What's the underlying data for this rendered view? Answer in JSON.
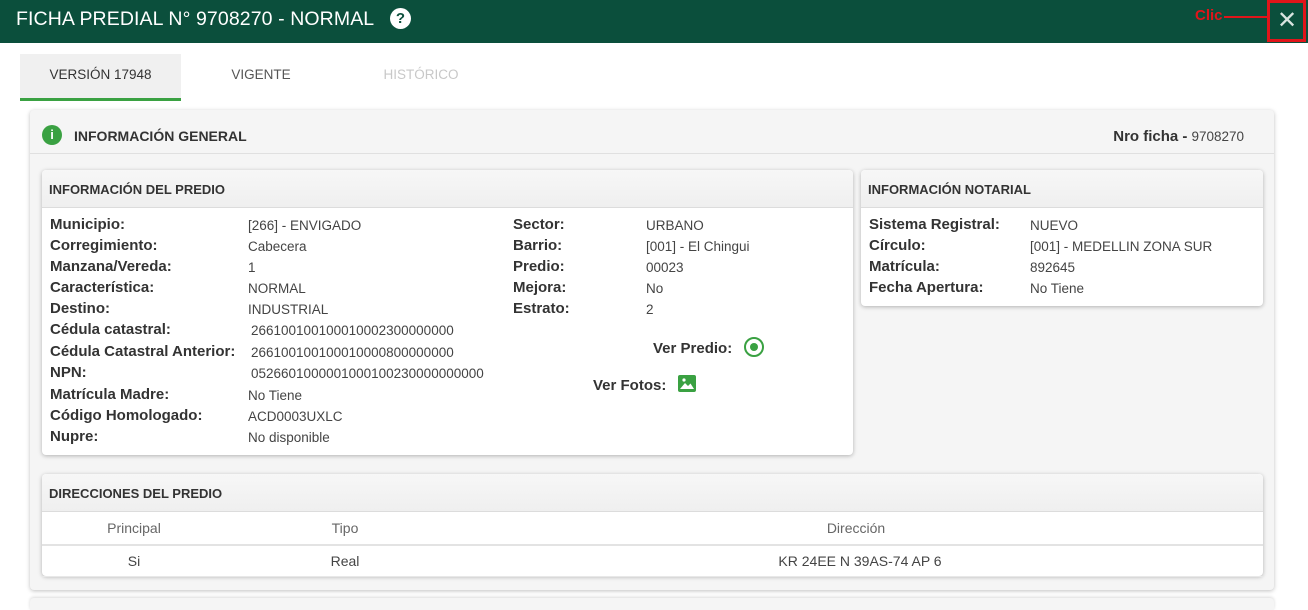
{
  "header": {
    "title": "FICHA PREDIAL N° 9708270 - NORMAL",
    "help_icon": "question-circle-icon",
    "annotation": "Clic",
    "close_icon": "close-icon",
    "close_glyph": "✕",
    "bg_color": "#0b4f3c",
    "annotation_color": "#e0151a"
  },
  "tabs": [
    {
      "label": "VERSIÓN 17948",
      "state": "active"
    },
    {
      "label": "VIGENTE",
      "state": "normal"
    },
    {
      "label": "HISTÓRICO",
      "state": "disabled"
    }
  ],
  "general": {
    "title": "INFORMACIÓN GENERAL",
    "nro_label": "Nro ficha -",
    "nro_value": "9708270",
    "info_icon": "info-icon",
    "info_glyph": "i"
  },
  "predio": {
    "title": "INFORMACIÓN DEL PREDIO",
    "left_fields": [
      {
        "label": "Municipio:",
        "value": "[266] - ENVIGADO"
      },
      {
        "label": "Corregimiento:",
        "value": "Cabecera"
      },
      {
        "label": "Manzana/Vereda:",
        "value": "1"
      },
      {
        "label": "Característica:",
        "value": "NORMAL"
      },
      {
        "label": "Destino:",
        "value": "INDUSTRIAL"
      },
      {
        "label": "Cédula catastral:",
        "value": "266100100100010002300000000"
      },
      {
        "label": "Cédula Catastral Anterior:",
        "value": "266100100100010000800000000"
      },
      {
        "label": "NPN:",
        "value": "0526601000001000100230000000000"
      },
      {
        "label": "Matrícula Madre:",
        "value": "No Tiene"
      },
      {
        "label": "Código Homologado:",
        "value": "ACD0003UXLC"
      },
      {
        "label": "Nupre:",
        "value": "No disponible"
      }
    ],
    "right_fields": [
      {
        "label": "Sector:",
        "value": "URBANO"
      },
      {
        "label": "Barrio:",
        "value": "[001] - El Chingui"
      },
      {
        "label": "Predio:",
        "value": "00023"
      },
      {
        "label": "Mejora:",
        "value": "No"
      },
      {
        "label": "Estrato:",
        "value": "2"
      }
    ],
    "ver_predio": "Ver Predio:",
    "ver_fotos": "Ver Fotos:",
    "ver_predio_icon": "location-target-icon",
    "ver_fotos_icon": "image-icon"
  },
  "notarial": {
    "title": "INFORMACIÓN NOTARIAL",
    "fields": [
      {
        "label": "Sistema Registral:",
        "value": "NUEVO"
      },
      {
        "label": "Círculo:",
        "value": "[001] - MEDELLIN ZONA SUR"
      },
      {
        "label": "Matrícula:",
        "value": "892645"
      },
      {
        "label": "Fecha Apertura:",
        "value": "No Tiene"
      }
    ]
  },
  "direcciones": {
    "title": "DIRECCIONES DEL PREDIO",
    "columns": [
      "Principal",
      "Tipo",
      "Dirección"
    ],
    "rows": [
      [
        "Si",
        "Real",
        "KR 24EE N 39AS-74 AP 6"
      ]
    ]
  }
}
